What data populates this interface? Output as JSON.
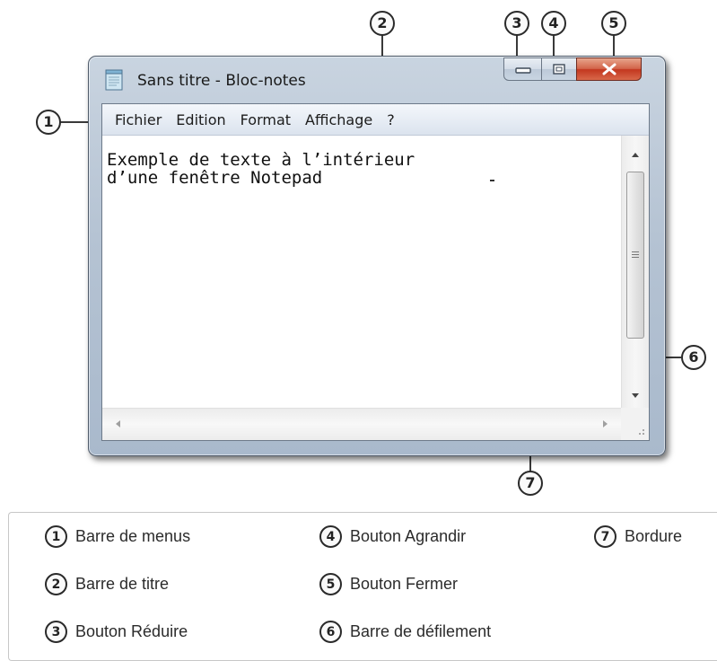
{
  "window": {
    "title": "Sans titre - Bloc-notes",
    "menu": [
      "Fichier",
      "Edition",
      "Format",
      "Affichage",
      "?"
    ],
    "text_lines": [
      "Exemple de texte à l’intérieur",
      "d’une fenêtre Notepad"
    ],
    "caption_buttons": {
      "minimize_icon": "minimize-icon",
      "maximize_icon": "maximize-icon",
      "close_icon": "close-x-icon"
    },
    "colors": {
      "frame": "#b5c3d3",
      "close_button": "#c3371f",
      "menubar": "#e6ecf4"
    }
  },
  "callouts": [
    "1",
    "2",
    "3",
    "4",
    "5",
    "6",
    "7"
  ],
  "legend": [
    {
      "num": "1",
      "label": "Barre de menus"
    },
    {
      "num": "2",
      "label": "Barre de titre"
    },
    {
      "num": "3",
      "label": "Bouton Réduire"
    },
    {
      "num": "4",
      "label": "Bouton Agrandir"
    },
    {
      "num": "5",
      "label": "Bouton Fermer"
    },
    {
      "num": "6",
      "label": "Barre de défilement"
    },
    {
      "num": "7",
      "label": "Bordure"
    }
  ]
}
